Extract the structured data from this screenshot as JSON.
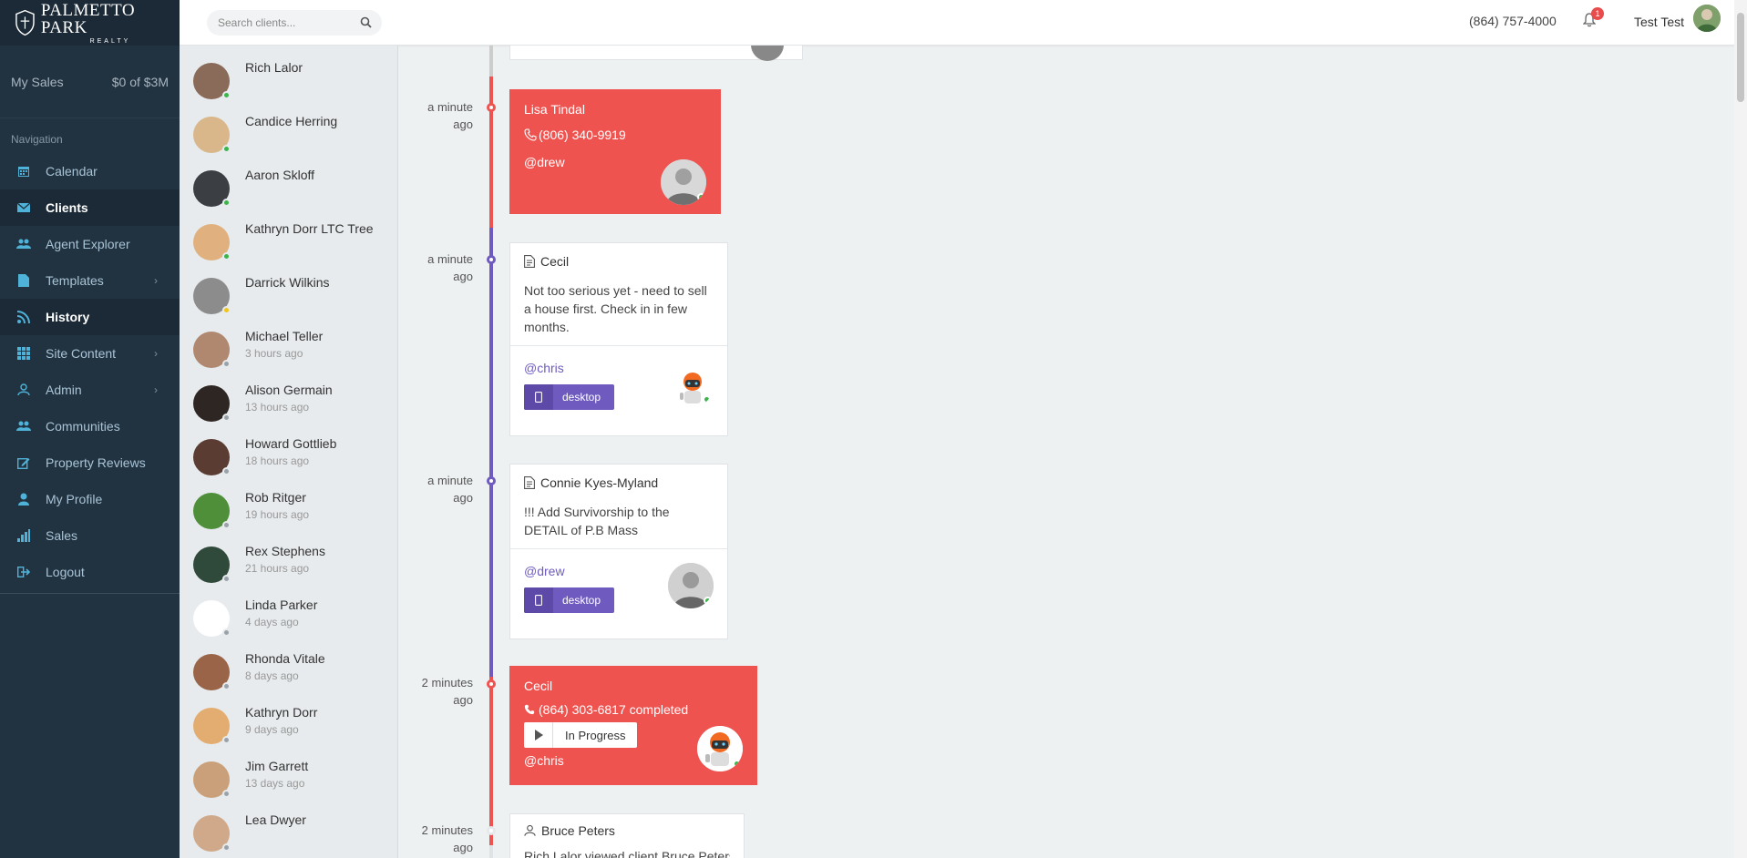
{
  "brand": {
    "name": "PALMETTO PARK",
    "sub": "REALTY"
  },
  "sidebar": {
    "my_sales_label": "My Sales",
    "my_sales_value": "$0 of $3M",
    "nav_heading": "Navigation",
    "items": [
      {
        "label": "Calendar",
        "icon": "calendar-icon"
      },
      {
        "label": "Clients",
        "icon": "envelope-icon"
      },
      {
        "label": "Agent Explorer",
        "icon": "users-icon"
      },
      {
        "label": "Templates",
        "icon": "file-icon"
      },
      {
        "label": "History",
        "icon": "rss-icon"
      },
      {
        "label": "Site Content",
        "icon": "grid-icon"
      },
      {
        "label": "Admin",
        "icon": "user-outline-icon"
      },
      {
        "label": "Communities",
        "icon": "users-icon"
      },
      {
        "label": "Property Reviews",
        "icon": "edit-icon"
      },
      {
        "label": "My Profile",
        "icon": "user-icon"
      },
      {
        "label": "Sales",
        "icon": "bar-chart-icon"
      },
      {
        "label": "Logout",
        "icon": "sign-out-icon"
      }
    ]
  },
  "topbar": {
    "search_placeholder": "Search clients...",
    "phone": "(864) 757-4000",
    "notification_count": "1",
    "username": "Test Test"
  },
  "clients": [
    {
      "name": "Rich Lalor",
      "time": "",
      "status": "online"
    },
    {
      "name": "Candice Herring",
      "time": "",
      "status": "online"
    },
    {
      "name": "Aaron Skloff",
      "time": "",
      "status": "online"
    },
    {
      "name": "Kathryn Dorr LTC Tree",
      "time": "",
      "status": "online"
    },
    {
      "name": "Darrick Wilkins",
      "time": "",
      "status": "away"
    },
    {
      "name": "Michael Teller",
      "time": "3 hours ago",
      "status": "offline"
    },
    {
      "name": "Alison Germain",
      "time": "13 hours ago",
      "status": "offline"
    },
    {
      "name": "Howard Gottlieb",
      "time": "18 hours ago",
      "status": "offline"
    },
    {
      "name": "Rob Ritger",
      "time": "19 hours ago",
      "status": "offline"
    },
    {
      "name": "Rex Stephens",
      "time": "21 hours ago",
      "status": "offline"
    },
    {
      "name": "Linda Parker",
      "time": "4 days ago",
      "status": "offline"
    },
    {
      "name": "Rhonda Vitale",
      "time": "8 days ago",
      "status": "offline"
    },
    {
      "name": "Kathryn Dorr",
      "time": "9 days ago",
      "status": "offline"
    },
    {
      "name": "Jim Garrett",
      "time": "13 days ago",
      "status": "offline"
    },
    {
      "name": "Lea Dwyer",
      "time": "",
      "status": "offline"
    }
  ],
  "timeline": [
    {
      "time_1": "a minute",
      "time_2": "ago",
      "type": "call",
      "name": "Lisa Tindal",
      "phone": "(806) 340-9919",
      "mention": "@drew"
    },
    {
      "time_1": "a minute",
      "time_2": "ago",
      "type": "note",
      "name": "Cecil",
      "note": "Not too serious yet - need to sell a house first.  Check in in few months.",
      "mention": "@chris",
      "device": "desktop"
    },
    {
      "time_1": "a minute",
      "time_2": "ago",
      "type": "note",
      "name": "Connie Kyes-Myland",
      "note": "!!! Add Survivorship to the DETAIL of P.B Mass",
      "mention": "@drew",
      "device": "desktop"
    },
    {
      "time_1": "2 minutes",
      "time_2": "ago",
      "type": "call",
      "name": "Cecil",
      "phone": "(864) 303-6817 completed",
      "status": "In Progress",
      "mention": "@chris"
    },
    {
      "time_1": "2 minutes",
      "time_2": "ago",
      "type": "view",
      "name": "Bruce Peters",
      "note": "Rich Lalor viewed client Bruce Peters"
    }
  ],
  "colors": {
    "accent": "#4fb3d9",
    "call": "#ef5350",
    "note": "#6f5bbf",
    "sidebar": "#213341"
  }
}
